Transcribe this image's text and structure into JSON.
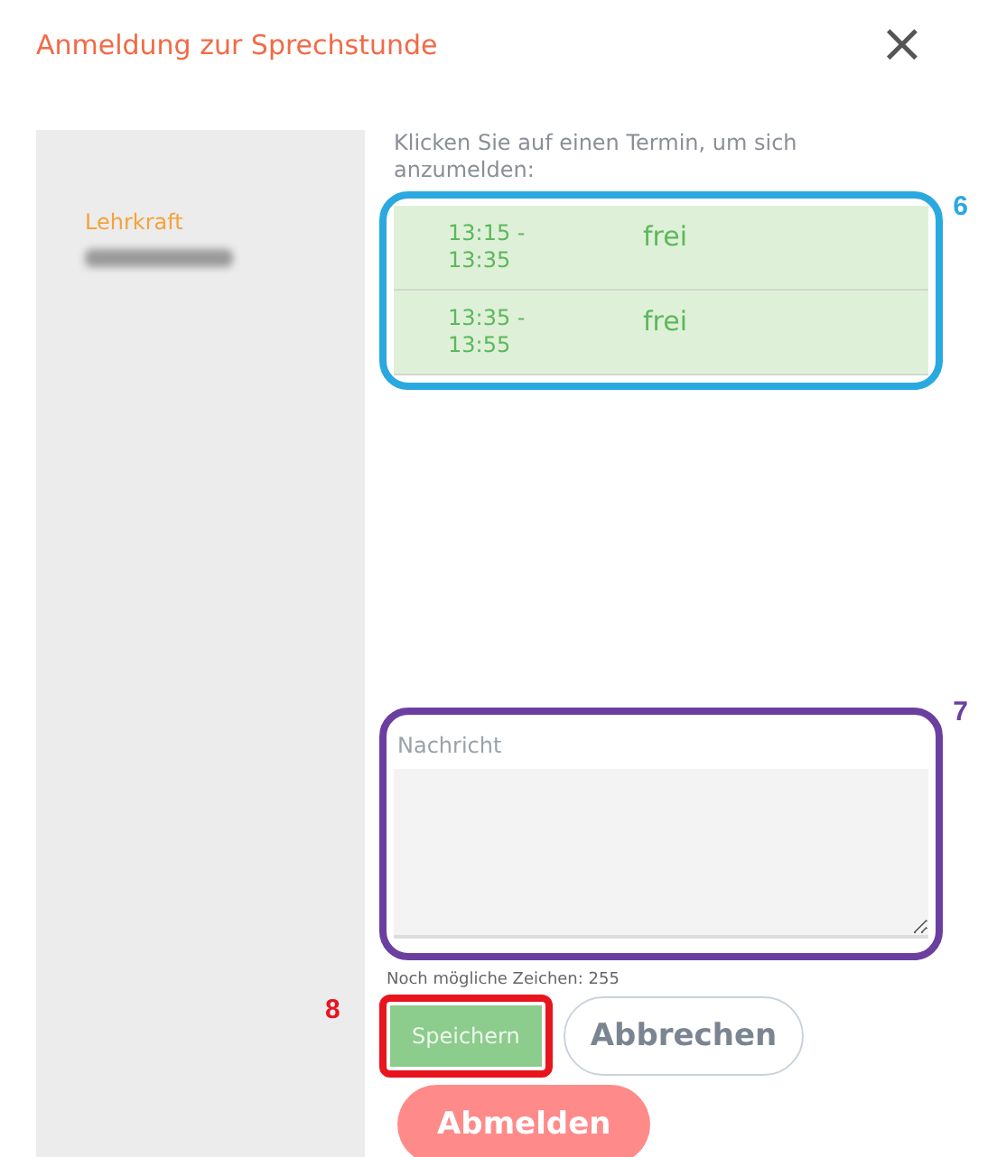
{
  "dialog": {
    "title": "Anmeldung zur Sprechstunde",
    "close_icon": "×"
  },
  "sidebar": {
    "label": "Lehrkraft",
    "name_blurred": true
  },
  "instruction": "Klicken Sie auf einen Termin, um sich anzumelden:",
  "slots": [
    {
      "time": "13:15 - 13:35",
      "status": "frei"
    },
    {
      "time": "13:35 - 13:55",
      "status": "frei"
    }
  ],
  "message": {
    "label": "Nachricht",
    "counter": "Noch mögliche Zeichen: 255"
  },
  "buttons": [
    {
      "kind": "primary",
      "label": "Speichern"
    },
    {
      "kind": "outline",
      "label": "Abbrechen"
    },
    {
      "kind": "danger",
      "label": "Abmelden"
    }
  ],
  "callouts": [
    {
      "number": "6",
      "color": "#2aa8e0"
    },
    {
      "number": "7",
      "color": "#6b3fa0"
    },
    {
      "number": "8",
      "color": "#e8141e"
    }
  ]
}
